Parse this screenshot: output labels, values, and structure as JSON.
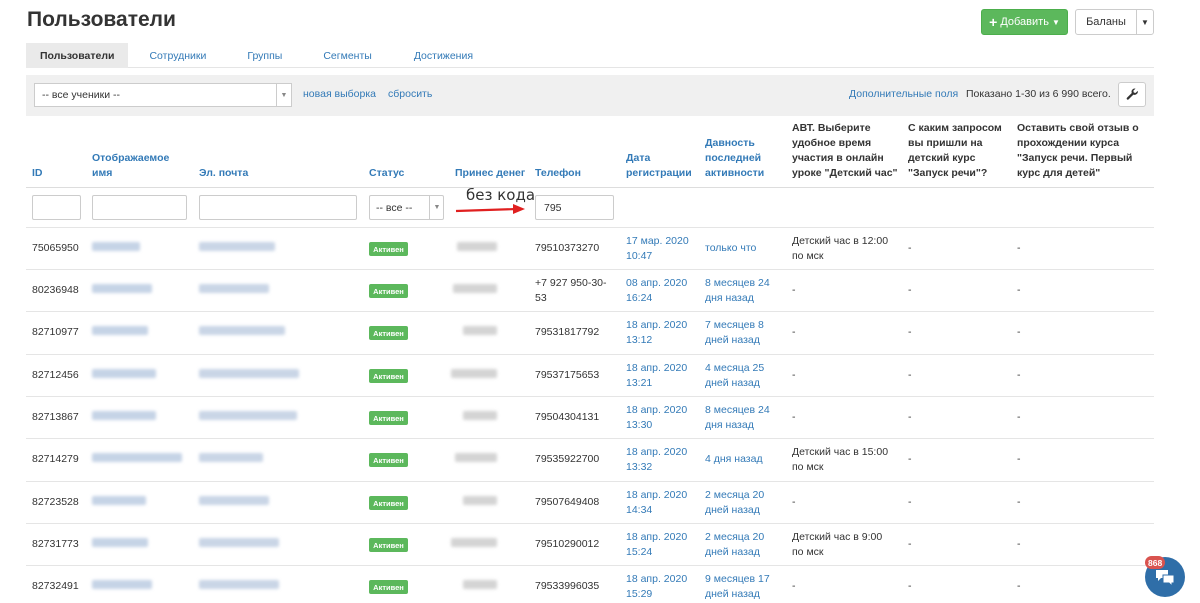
{
  "page": {
    "title": "Пользователи"
  },
  "header_buttons": {
    "add_label": "Добавить",
    "balances_label": "Баланы"
  },
  "tabs": [
    {
      "label": "Пользователи",
      "active": true
    },
    {
      "label": "Сотрудники"
    },
    {
      "label": "Группы"
    },
    {
      "label": "Сегменты"
    },
    {
      "label": "Достижения"
    }
  ],
  "filter": {
    "students_select": "-- все ученики --",
    "new_selection": "новая выборка",
    "reset": "сбросить",
    "extra_fields": "Дополнительные поля",
    "shown": "Показано 1-30 из 6 990 всего."
  },
  "columns": [
    {
      "label": "ID"
    },
    {
      "label": "Отображаемое имя"
    },
    {
      "label": "Эл. почта"
    },
    {
      "label": "Статус"
    },
    {
      "label": "Принес денег"
    },
    {
      "label": "Телефон"
    },
    {
      "label": "Дата регистрации"
    },
    {
      "label": "Давность последней активности"
    },
    {
      "label": "АВТ. Выберите удобное время участия в онлайн уроке \"Детский час\""
    },
    {
      "label": "С каким запросом вы пришли на детский курс \"Запуск речи\"?"
    },
    {
      "label": "Оставить свой отзыв о прохождении курса \"Запуск речи. Первый курс для детей\""
    }
  ],
  "column_filters": {
    "status": "-- все --",
    "phone": "795"
  },
  "annotation": {
    "text": "без кода"
  },
  "rows": [
    {
      "id": "75065950",
      "status": "Активен",
      "phone": "79510373270",
      "reg_date": "17 мар. 2020",
      "reg_time": "10:47",
      "last_activity": "только что",
      "q1": "Детский час в 12:00 по мск",
      "q2": "-",
      "q3": "-"
    },
    {
      "id": "80236948",
      "status": "Активен",
      "phone": "+7 927 950-30-53",
      "reg_date": "08 апр. 2020",
      "reg_time": "16:24",
      "last_activity": "8 месяцев 24 дня назад",
      "q1": "-",
      "q2": "-",
      "q3": "-"
    },
    {
      "id": "82710977",
      "status": "Активен",
      "phone": "79531817792",
      "reg_date": "18 апр. 2020",
      "reg_time": "13:12",
      "last_activity": "7 месяцев 8 дней назад",
      "q1": "-",
      "q2": "-",
      "q3": "-"
    },
    {
      "id": "82712456",
      "status": "Активен",
      "phone": "79537175653",
      "reg_date": "18 апр. 2020",
      "reg_time": "13:21",
      "last_activity": "4 месяца 25 дней назад",
      "q1": "-",
      "q2": "-",
      "q3": "-"
    },
    {
      "id": "82713867",
      "status": "Активен",
      "phone": "79504304131",
      "reg_date": "18 апр. 2020",
      "reg_time": "13:30",
      "last_activity": "8 месяцев 24 дня назад",
      "q1": "-",
      "q2": "-",
      "q3": "-"
    },
    {
      "id": "82714279",
      "status": "Активен",
      "phone": "79535922700",
      "reg_date": "18 апр. 2020",
      "reg_time": "13:32",
      "last_activity": "4 дня назад",
      "q1": "Детский час в 15:00 по мск",
      "q2": "-",
      "q3": "-"
    },
    {
      "id": "82723528",
      "status": "Активен",
      "phone": "79507649408",
      "reg_date": "18 апр. 2020",
      "reg_time": "14:34",
      "last_activity": "2 месяца 20 дней назад",
      "q1": "-",
      "q2": "-",
      "q3": "-"
    },
    {
      "id": "82731773",
      "status": "Активен",
      "phone": "79510290012",
      "reg_date": "18 апр. 2020",
      "reg_time": "15:24",
      "last_activity": "2 месяца 20 дней назад",
      "q1": "Детский час в 9:00 по мск",
      "q2": "-",
      "q3": "-"
    },
    {
      "id": "82732491",
      "status": "Активен",
      "phone": "79533996035",
      "reg_date": "18 апр. 2020",
      "reg_time": "15:29",
      "last_activity": "9 месяцев 17 дней назад",
      "q1": "-",
      "q2": "-",
      "q3": "-"
    }
  ],
  "chat": {
    "count": "868"
  },
  "colors": {
    "accent": "#337ab7",
    "success": "#5cb85c",
    "annotation_arrow": "#e02020"
  }
}
